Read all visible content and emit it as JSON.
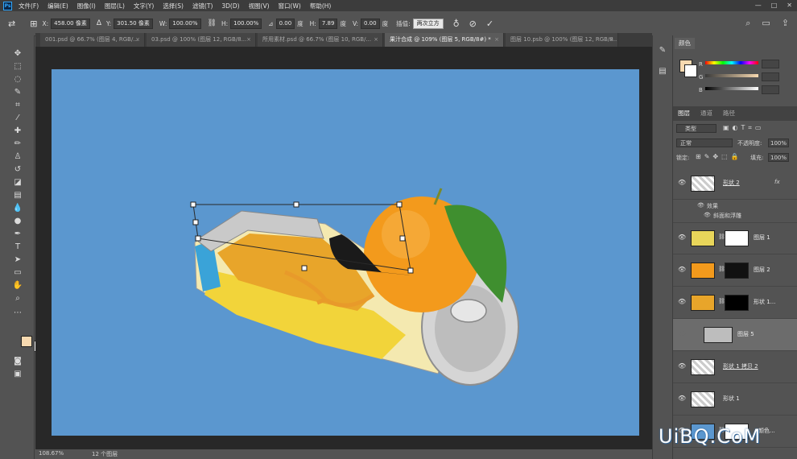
{
  "app": {
    "logo": "Ps"
  },
  "menu": [
    "文件(F)",
    "编辑(E)",
    "图像(I)",
    "图层(L)",
    "文字(Y)",
    "选择(S)",
    "滤镜(T)",
    "3D(D)",
    "视图(V)",
    "窗口(W)",
    "帮助(H)"
  ],
  "window_controls": {
    "minimize": "—",
    "maximize": "□",
    "close": "✕"
  },
  "options": {
    "x_label": "X:",
    "x_value": "458.00 像素",
    "y_label": "Y:",
    "y_value": "301.50 像素",
    "w_label": "W:",
    "w_value": "100.00%",
    "h_label": "H:",
    "h_value": "100.00%",
    "angle_value": "0.00",
    "angle_unit": "度",
    "hskew_label": "H:",
    "hskew_value": "7.89",
    "hskew_unit": "度",
    "vskew_label": "V:",
    "vskew_value": "0.00",
    "vskew_unit": "度",
    "interp_label": "插值:",
    "interp_value": "两次立方"
  },
  "tabs": [
    {
      "label": "001.psd @ 66.7% (图层 4, RGB/...",
      "close": "×"
    },
    {
      "label": "03.psd @ 100% (图层 12, RGB/8...",
      "close": "×"
    },
    {
      "label": "所用素材.psd @ 66.7% (图层 10, RGB/...",
      "close": "×"
    },
    {
      "label": "果汁合成 @ 109% (图层 5, RGB/8#) *",
      "close": "×"
    },
    {
      "label": "图层 10.psb @ 100% (图层 12, RGB/8...",
      "close": "×"
    }
  ],
  "status": {
    "zoom": "108.67%",
    "info": "12 个图层"
  },
  "color_panel": {
    "tab": "颜色",
    "r": "R",
    "g": "G",
    "b": "B"
  },
  "layers_panel": {
    "tabs": [
      "图层",
      "通道",
      "路径"
    ],
    "filter_label": "类型",
    "blend_mode": "正常",
    "opacity_label": "不透明度:",
    "opacity_value": "100%",
    "lock_label": "锁定:",
    "fill_label": "填充:",
    "fill_value": "100%",
    "effects_label": "效果",
    "bevel_label": "斜面和浮雕",
    "layers": [
      {
        "name": "形状 2",
        "fx": "fx"
      },
      {
        "name": "图层 1"
      },
      {
        "name": "图层 2"
      },
      {
        "name": "形状 1..."
      },
      {
        "name": "图层 5"
      },
      {
        "name": "形状 1 拷贝 2"
      },
      {
        "name": "形状 1"
      },
      {
        "name": "颜色..."
      }
    ]
  },
  "watermark": "UiBQ.CoM",
  "colors": {
    "canvas": "#5b97cf",
    "foreground": "#f7d9b0",
    "background": "#ffffff",
    "orange": "#f39a1c"
  }
}
